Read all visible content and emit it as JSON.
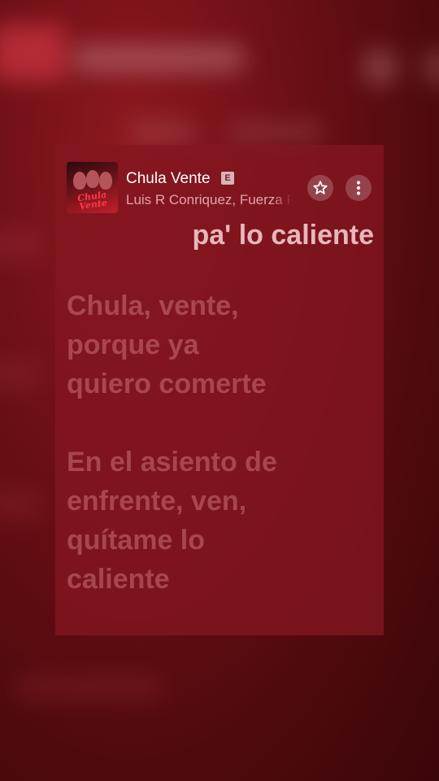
{
  "track": {
    "title": "Chula Vente",
    "explicit_badge": "E",
    "artist": "Luis R Conriquez, Fuerza Regida",
    "album_art_text": "Chula Vente"
  },
  "actions": {
    "favorite_icon": "star-icon",
    "more_icon": "more-vertical-icon"
  },
  "lyrics": {
    "active_line": "pa' lo caliente",
    "stanzas": [
      {
        "lines": [
          "Chula, vente,",
          "porque ya",
          "quiero comerte"
        ]
      },
      {
        "lines": [
          "En el asiento de",
          "enfrente, ven,",
          "quítame lo",
          "caliente"
        ]
      }
    ]
  },
  "colors": {
    "background": "#6e1016",
    "card": "#84161f",
    "active_lyric": "#e7b7ba",
    "inactive_lyric": "#c86a72"
  }
}
